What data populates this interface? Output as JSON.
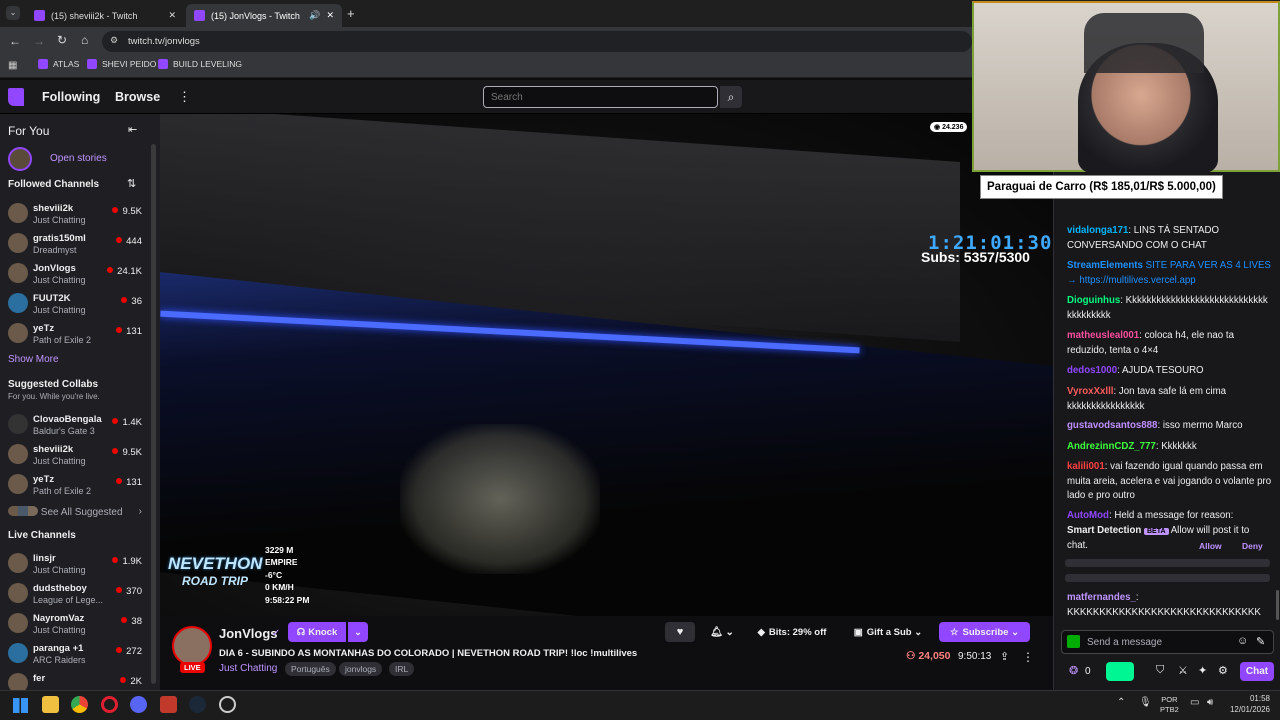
{
  "browser": {
    "tabs": [
      {
        "title": "(15) sheviii2k - Twitch"
      },
      {
        "title": "(15) JonVlogs - Twitch"
      }
    ],
    "url": "twitch.tv/jonvlogs",
    "bookmarks": [
      "ATLAS",
      "SHEVI PEIDO",
      "BUILD LEVELING"
    ]
  },
  "nav": {
    "following": "Following",
    "browse": "Browse",
    "search_placeholder": "Search"
  },
  "sidebar": {
    "for_you": "For You",
    "open_stories": "Open stories",
    "followed_title": "Followed Channels",
    "followed": [
      {
        "name": "sheviii2k",
        "game": "Just Chatting",
        "viewers": "9.5K"
      },
      {
        "name": "gratis150ml",
        "game": "Dreadmyst",
        "viewers": "444"
      },
      {
        "name": "JonVlogs",
        "game": "Just Chatting",
        "viewers": "24.1K"
      },
      {
        "name": "FUUT2K",
        "game": "Just Chatting",
        "viewers": "36"
      },
      {
        "name": "yeTz",
        "game": "Path of Exile 2",
        "viewers": "131"
      }
    ],
    "show_more": "Show More",
    "collabs_title": "Suggested Collabs",
    "collabs_sub": "For you. While you're live.",
    "collabs": [
      {
        "name": "ClovaoBengala",
        "game": "Baldur's Gate 3",
        "viewers": "1.4K"
      },
      {
        "name": "sheviii2k",
        "game": "Just Chatting",
        "viewers": "9.5K"
      },
      {
        "name": "yeTz",
        "game": "Path of Exile 2",
        "viewers": "131"
      }
    ],
    "see_all": "See All Suggested",
    "live_title": "Live Channels",
    "live": [
      {
        "name": "linsjr",
        "game": "Just Chatting",
        "viewers": "1.9K"
      },
      {
        "name": "dudstheboy",
        "game": "League of Lege...",
        "viewers": "370"
      },
      {
        "name": "NayromVaz",
        "game": "Just Chatting",
        "viewers": "38"
      },
      {
        "name": "paranga +1",
        "game": "ARC Raiders",
        "viewers": "272"
      },
      {
        "name": "fer",
        "game": "",
        "viewers": "2K"
      }
    ]
  },
  "overlay": {
    "timer": "1:21:01:30",
    "subs": "Subs: 5357/5300",
    "goal": "Paraguai de Carro (R$ 185,01/R$ 5.000,00)",
    "points": "24.236",
    "logo_line1": "NEVETHON",
    "logo_line2": "ROAD TRIP",
    "telemetry": [
      "3229 M",
      "EMPIRE",
      "-6°C",
      "0 KM/H",
      "9:58:22 PM"
    ]
  },
  "stream": {
    "channel": "JonVlogs",
    "knock": "Knock",
    "title": "DIA 6 - SUBINDO AS MONTANHAS DO COLORADO | NEVETHON ROAD TRIP! !loc !multilives",
    "category": "Just Chatting",
    "tags": [
      "Português",
      "jonvlogs",
      "IRL"
    ],
    "live_badge": "LIVE",
    "bits": "Bits: 29% off",
    "gift": "Gift a Sub",
    "subscribe": "Subscribe",
    "viewers": "24,050",
    "uptime": "9:50:13"
  },
  "chat": {
    "messages": [
      {
        "user": "vidalonga171",
        "color": "#00b5ff",
        "text": "LINS TÁ SENTADO CONVERSANDO COM O CHAT"
      },
      {
        "user": "StreamElements",
        "color": "#1e90ff",
        "text": "SITE PARA VER AS 4 LIVES → https://multilives.vercel.app"
      },
      {
        "user": "Dioguinhus",
        "color": "#00ff7f",
        "text": "Kkkkkkkkkkkkkkkkkkkkkkkkkkkkkkkkkkkkkk"
      },
      {
        "user": "matheusleal001",
        "color": "#ff4ea0",
        "text": "coloca h4, ele nao ta reduzido, tenta o 4×4"
      },
      {
        "user": "dedos1000",
        "color": "#9146ff",
        "text": "AJUDA TESOURO"
      },
      {
        "user": "VyroxXxlll",
        "color": "#ff5a5a",
        "text": "Jon tava safe lá em cima kkkkkkkkkkkkkkkk"
      },
      {
        "user": "gustavodsantos888",
        "color": "#c08fff",
        "text": "isso mermo Marco"
      },
      {
        "user": "AndrezinnCDZ_777",
        "color": "#3cff3c",
        "text": "Kkkkkkk"
      },
      {
        "user": "kalili001",
        "color": "#ff4040",
        "text": "vai fazendo igual quando passa em muita areia, acelera e vai jogando o volante pro lado e pro outro"
      },
      {
        "user": "AutoMod",
        "color": "#9146ff",
        "text": "Held a message for reason:"
      },
      {
        "user": "matfernandes_",
        "color": "#bf94ff",
        "text": "KKKKKKKKKKKKKKKKKKKKKKKKKKKKKK"
      }
    ],
    "automod_reason": "Smart Detection",
    "automod_beta": "BETA",
    "automod_tail": "Allow will post it to chat.",
    "allow": "Allow",
    "deny": "Deny",
    "placeholder": "Send a message",
    "points": "0",
    "chat_button": "Chat"
  },
  "taskbar": {
    "lang1": "POR",
    "lang2": "PTB2",
    "time": "01:58",
    "date": "12/01/2026"
  }
}
